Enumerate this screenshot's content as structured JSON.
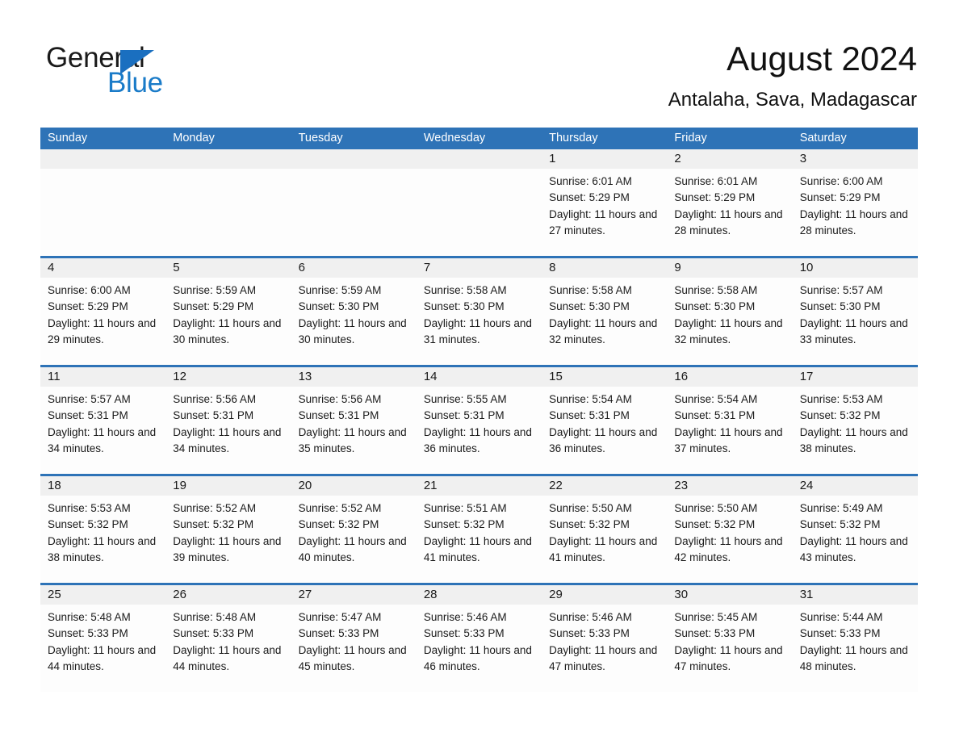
{
  "brand": {
    "word_one": "General",
    "word_two": "Blue",
    "triangle_icon": "triangle-logo-icon",
    "accent_color": "#1a7bc8"
  },
  "header": {
    "title": "August 2024",
    "subtitle": "Antalaha, Sava, Madagascar"
  },
  "theme": {
    "header_blue": "#2e73b7",
    "daynum_band": "#f0f0f0",
    "cell_background": "#fdfdfd",
    "text": "#1a1a1a"
  },
  "weekdays": [
    "Sunday",
    "Monday",
    "Tuesday",
    "Wednesday",
    "Thursday",
    "Friday",
    "Saturday"
  ],
  "weeks": [
    [
      {
        "day": "",
        "sunrise": "",
        "sunset": "",
        "daylight": ""
      },
      {
        "day": "",
        "sunrise": "",
        "sunset": "",
        "daylight": ""
      },
      {
        "day": "",
        "sunrise": "",
        "sunset": "",
        "daylight": ""
      },
      {
        "day": "",
        "sunrise": "",
        "sunset": "",
        "daylight": ""
      },
      {
        "day": "1",
        "sunrise": "Sunrise: 6:01 AM",
        "sunset": "Sunset: 5:29 PM",
        "daylight": "Daylight: 11 hours and 27 minutes."
      },
      {
        "day": "2",
        "sunrise": "Sunrise: 6:01 AM",
        "sunset": "Sunset: 5:29 PM",
        "daylight": "Daylight: 11 hours and 28 minutes."
      },
      {
        "day": "3",
        "sunrise": "Sunrise: 6:00 AM",
        "sunset": "Sunset: 5:29 PM",
        "daylight": "Daylight: 11 hours and 28 minutes."
      }
    ],
    [
      {
        "day": "4",
        "sunrise": "Sunrise: 6:00 AM",
        "sunset": "Sunset: 5:29 PM",
        "daylight": "Daylight: 11 hours and 29 minutes."
      },
      {
        "day": "5",
        "sunrise": "Sunrise: 5:59 AM",
        "sunset": "Sunset: 5:29 PM",
        "daylight": "Daylight: 11 hours and 30 minutes."
      },
      {
        "day": "6",
        "sunrise": "Sunrise: 5:59 AM",
        "sunset": "Sunset: 5:30 PM",
        "daylight": "Daylight: 11 hours and 30 minutes."
      },
      {
        "day": "7",
        "sunrise": "Sunrise: 5:58 AM",
        "sunset": "Sunset: 5:30 PM",
        "daylight": "Daylight: 11 hours and 31 minutes."
      },
      {
        "day": "8",
        "sunrise": "Sunrise: 5:58 AM",
        "sunset": "Sunset: 5:30 PM",
        "daylight": "Daylight: 11 hours and 32 minutes."
      },
      {
        "day": "9",
        "sunrise": "Sunrise: 5:58 AM",
        "sunset": "Sunset: 5:30 PM",
        "daylight": "Daylight: 11 hours and 32 minutes."
      },
      {
        "day": "10",
        "sunrise": "Sunrise: 5:57 AM",
        "sunset": "Sunset: 5:30 PM",
        "daylight": "Daylight: 11 hours and 33 minutes."
      }
    ],
    [
      {
        "day": "11",
        "sunrise": "Sunrise: 5:57 AM",
        "sunset": "Sunset: 5:31 PM",
        "daylight": "Daylight: 11 hours and 34 minutes."
      },
      {
        "day": "12",
        "sunrise": "Sunrise: 5:56 AM",
        "sunset": "Sunset: 5:31 PM",
        "daylight": "Daylight: 11 hours and 34 minutes."
      },
      {
        "day": "13",
        "sunrise": "Sunrise: 5:56 AM",
        "sunset": "Sunset: 5:31 PM",
        "daylight": "Daylight: 11 hours and 35 minutes."
      },
      {
        "day": "14",
        "sunrise": "Sunrise: 5:55 AM",
        "sunset": "Sunset: 5:31 PM",
        "daylight": "Daylight: 11 hours and 36 minutes."
      },
      {
        "day": "15",
        "sunrise": "Sunrise: 5:54 AM",
        "sunset": "Sunset: 5:31 PM",
        "daylight": "Daylight: 11 hours and 36 minutes."
      },
      {
        "day": "16",
        "sunrise": "Sunrise: 5:54 AM",
        "sunset": "Sunset: 5:31 PM",
        "daylight": "Daylight: 11 hours and 37 minutes."
      },
      {
        "day": "17",
        "sunrise": "Sunrise: 5:53 AM",
        "sunset": "Sunset: 5:32 PM",
        "daylight": "Daylight: 11 hours and 38 minutes."
      }
    ],
    [
      {
        "day": "18",
        "sunrise": "Sunrise: 5:53 AM",
        "sunset": "Sunset: 5:32 PM",
        "daylight": "Daylight: 11 hours and 38 minutes."
      },
      {
        "day": "19",
        "sunrise": "Sunrise: 5:52 AM",
        "sunset": "Sunset: 5:32 PM",
        "daylight": "Daylight: 11 hours and 39 minutes."
      },
      {
        "day": "20",
        "sunrise": "Sunrise: 5:52 AM",
        "sunset": "Sunset: 5:32 PM",
        "daylight": "Daylight: 11 hours and 40 minutes."
      },
      {
        "day": "21",
        "sunrise": "Sunrise: 5:51 AM",
        "sunset": "Sunset: 5:32 PM",
        "daylight": "Daylight: 11 hours and 41 minutes."
      },
      {
        "day": "22",
        "sunrise": "Sunrise: 5:50 AM",
        "sunset": "Sunset: 5:32 PM",
        "daylight": "Daylight: 11 hours and 41 minutes."
      },
      {
        "day": "23",
        "sunrise": "Sunrise: 5:50 AM",
        "sunset": "Sunset: 5:32 PM",
        "daylight": "Daylight: 11 hours and 42 minutes."
      },
      {
        "day": "24",
        "sunrise": "Sunrise: 5:49 AM",
        "sunset": "Sunset: 5:32 PM",
        "daylight": "Daylight: 11 hours and 43 minutes."
      }
    ],
    [
      {
        "day": "25",
        "sunrise": "Sunrise: 5:48 AM",
        "sunset": "Sunset: 5:33 PM",
        "daylight": "Daylight: 11 hours and 44 minutes."
      },
      {
        "day": "26",
        "sunrise": "Sunrise: 5:48 AM",
        "sunset": "Sunset: 5:33 PM",
        "daylight": "Daylight: 11 hours and 44 minutes."
      },
      {
        "day": "27",
        "sunrise": "Sunrise: 5:47 AM",
        "sunset": "Sunset: 5:33 PM",
        "daylight": "Daylight: 11 hours and 45 minutes."
      },
      {
        "day": "28",
        "sunrise": "Sunrise: 5:46 AM",
        "sunset": "Sunset: 5:33 PM",
        "daylight": "Daylight: 11 hours and 46 minutes."
      },
      {
        "day": "29",
        "sunrise": "Sunrise: 5:46 AM",
        "sunset": "Sunset: 5:33 PM",
        "daylight": "Daylight: 11 hours and 47 minutes."
      },
      {
        "day": "30",
        "sunrise": "Sunrise: 5:45 AM",
        "sunset": "Sunset: 5:33 PM",
        "daylight": "Daylight: 11 hours and 47 minutes."
      },
      {
        "day": "31",
        "sunrise": "Sunrise: 5:44 AM",
        "sunset": "Sunset: 5:33 PM",
        "daylight": "Daylight: 11 hours and 48 minutes."
      }
    ]
  ]
}
